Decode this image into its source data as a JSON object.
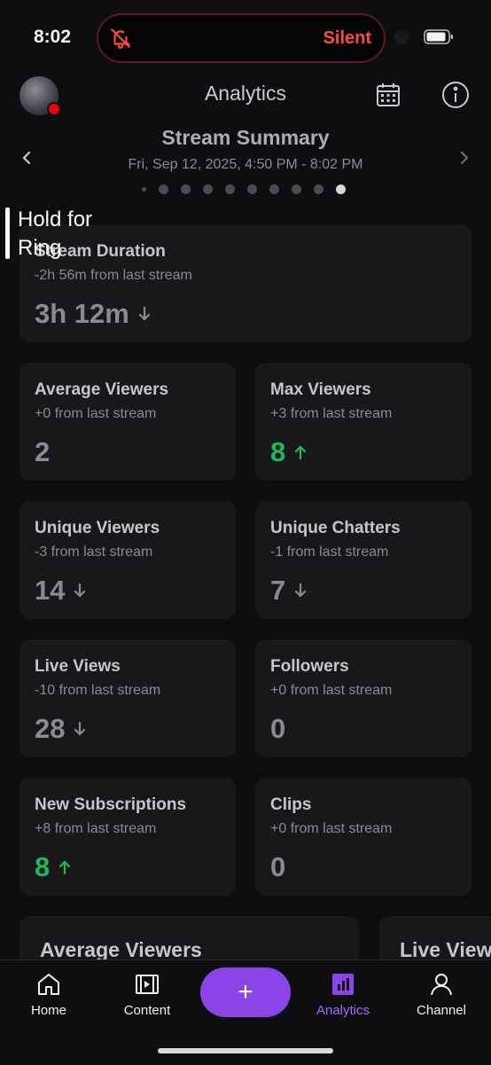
{
  "status": {
    "time": "8:02",
    "mode": "Silent"
  },
  "header": {
    "title": "Analytics"
  },
  "summary": {
    "title": "Stream Summary",
    "date": "Fri, Sep 12, 2025, 4:50 PM - 8:02 PM",
    "page_count": 10,
    "active_page": 9
  },
  "overlay": {
    "label": "Hold for Ring"
  },
  "stats": {
    "duration": {
      "title": "Stream Duration",
      "delta": "-2h 56m from last stream",
      "value": "3h 12m",
      "trend": "down"
    },
    "avg_viewers": {
      "title": "Average Viewers",
      "delta": "+0 from last stream",
      "value": "2",
      "trend": "none"
    },
    "max_viewers": {
      "title": "Max Viewers",
      "delta": "+3 from last stream",
      "value": "8",
      "trend": "up"
    },
    "unique_viewers": {
      "title": "Unique Viewers",
      "delta": "-3 from last stream",
      "value": "14",
      "trend": "down"
    },
    "unique_chatters": {
      "title": "Unique Chatters",
      "delta": "-1 from last stream",
      "value": "7",
      "trend": "down"
    },
    "live_views": {
      "title": "Live Views",
      "delta": "-10 from last stream",
      "value": "28",
      "trend": "down"
    },
    "followers": {
      "title": "Followers",
      "delta": "+0 from last stream",
      "value": "0",
      "trend": "none"
    },
    "new_subs": {
      "title": "New Subscriptions",
      "delta": "+8 from last stream",
      "value": "8",
      "trend": "up"
    },
    "clips": {
      "title": "Clips",
      "delta": "+0 from last stream",
      "value": "0",
      "trend": "none"
    }
  },
  "bottom_cards": {
    "left_title": "Average Viewers",
    "right_title": "Live Views"
  },
  "tabs": {
    "home": "Home",
    "content": "Content",
    "create": "+",
    "analytics": "Analytics",
    "channel": "Channel"
  },
  "colors": {
    "accent": "#9b6dff",
    "up": "#1fb85a",
    "live": "#eb0400",
    "silent": "#ff4a3d"
  }
}
